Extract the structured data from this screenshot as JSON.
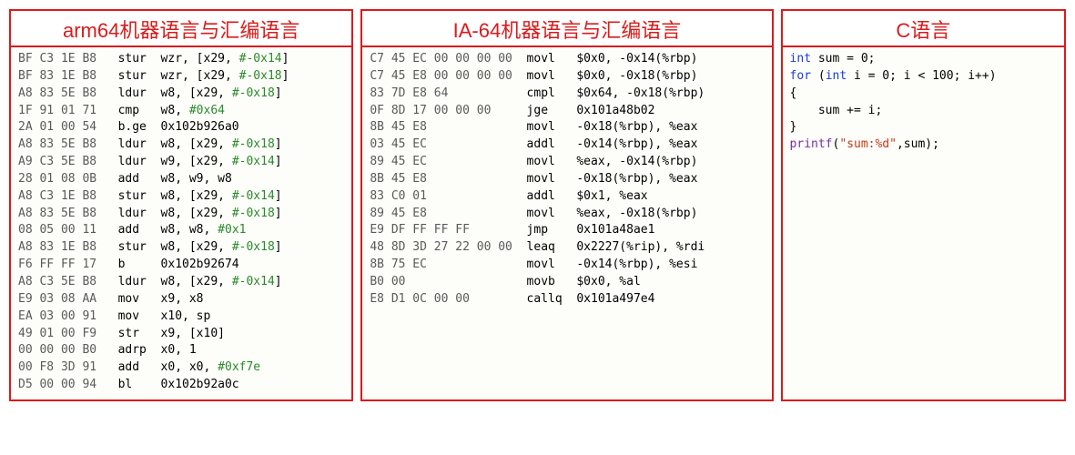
{
  "panels": [
    {
      "title": "arm64机器语言与汇编语言",
      "lines": [
        {
          "hex": "BF C3 1E B8",
          "mn": "stur",
          "op": "wzr, [x29, ",
          "imm": "#-0x14",
          "tail": "]"
        },
        {
          "hex": "BF 83 1E B8",
          "mn": "stur",
          "op": "wzr, [x29, ",
          "imm": "#-0x18",
          "tail": "]"
        },
        {
          "hex": "A8 83 5E B8",
          "mn": "ldur",
          "op": "w8, [x29, ",
          "imm": "#-0x18",
          "tail": "]"
        },
        {
          "hex": "1F 91 01 71",
          "mn": "cmp",
          "op": "w8, ",
          "imm": "#0x64",
          "tail": ""
        },
        {
          "hex": "2A 01 00 54",
          "mn": "b.ge",
          "op": "0x102b926a0",
          "imm": "",
          "tail": ""
        },
        {
          "hex": "A8 83 5E B8",
          "mn": "ldur",
          "op": "w8, [x29, ",
          "imm": "#-0x18",
          "tail": "]"
        },
        {
          "hex": "A9 C3 5E B8",
          "mn": "ldur",
          "op": "w9, [x29, ",
          "imm": "#-0x14",
          "tail": "]"
        },
        {
          "hex": "28 01 08 0B",
          "mn": "add",
          "op": "w8, w9, w8",
          "imm": "",
          "tail": ""
        },
        {
          "hex": "A8 C3 1E B8",
          "mn": "stur",
          "op": "w8, [x29, ",
          "imm": "#-0x14",
          "tail": "]"
        },
        {
          "hex": "A8 83 5E B8",
          "mn": "ldur",
          "op": "w8, [x29, ",
          "imm": "#-0x18",
          "tail": "]"
        },
        {
          "hex": "08 05 00 11",
          "mn": "add",
          "op": "w8, w8, ",
          "imm": "#0x1",
          "tail": ""
        },
        {
          "hex": "A8 83 1E B8",
          "mn": "stur",
          "op": "w8, [x29, ",
          "imm": "#-0x18",
          "tail": "]"
        },
        {
          "hex": "F6 FF FF 17",
          "mn": "b",
          "op": "0x102b92674",
          "imm": "",
          "tail": ""
        },
        {
          "hex": "A8 C3 5E B8",
          "mn": "ldur",
          "op": "w8, [x29, ",
          "imm": "#-0x14",
          "tail": "]"
        },
        {
          "hex": "E9 03 08 AA",
          "mn": "mov",
          "op": "x9, x8",
          "imm": "",
          "tail": ""
        },
        {
          "hex": "EA 03 00 91",
          "mn": "mov",
          "op": "x10, sp",
          "imm": "",
          "tail": ""
        },
        {
          "hex": "49 01 00 F9",
          "mn": "str",
          "op": "x9, [x10]",
          "imm": "",
          "tail": ""
        },
        {
          "hex": "00 00 00 B0",
          "mn": "adrp",
          "op": "x0, 1",
          "imm": "",
          "tail": ""
        },
        {
          "hex": "00 F8 3D 91",
          "mn": "add",
          "op": "x0, x0, ",
          "imm": "#0xf7e",
          "tail": ""
        },
        {
          "hex": "D5 00 00 94",
          "mn": "bl",
          "op": "0x102b92a0c",
          "imm": "",
          "tail": ""
        }
      ]
    },
    {
      "title": "IA-64机器语言与汇编语言",
      "lines": [
        {
          "hex": "C7 45 EC 00 00 00 00",
          "mn": "movl",
          "op": "$0x0, -0x14(%rbp)"
        },
        {
          "hex": "C7 45 E8 00 00 00 00",
          "mn": "movl",
          "op": "$0x0, -0x18(%rbp)"
        },
        {
          "hex": "83 7D E8 64",
          "mn": "cmpl",
          "op": "$0x64, -0x18(%rbp)"
        },
        {
          "hex": "0F 8D 17 00 00 00",
          "mn": "jge",
          "op": "0x101a48b02"
        },
        {
          "hex": "8B 45 E8",
          "mn": "movl",
          "op": "-0x18(%rbp), %eax"
        },
        {
          "hex": "03 45 EC",
          "mn": "addl",
          "op": "-0x14(%rbp), %eax"
        },
        {
          "hex": "89 45 EC",
          "mn": "movl",
          "op": "%eax, -0x14(%rbp)"
        },
        {
          "hex": "8B 45 E8",
          "mn": "movl",
          "op": "-0x18(%rbp), %eax"
        },
        {
          "hex": "83 C0 01",
          "mn": "addl",
          "op": "$0x1, %eax"
        },
        {
          "hex": "89 45 E8",
          "mn": "movl",
          "op": "%eax, -0x18(%rbp)"
        },
        {
          "hex": "E9 DF FF FF FF",
          "mn": "jmp",
          "op": "0x101a48ae1"
        },
        {
          "hex": "48 8D 3D 27 22 00 00",
          "mn": "leaq",
          "op": "0x2227(%rip), %rdi"
        },
        {
          "hex": "8B 75 EC",
          "mn": "movl",
          "op": "-0x14(%rbp), %esi"
        },
        {
          "hex": "B0 00",
          "mn": "movb",
          "op": "$0x0, %al"
        },
        {
          "hex": "E8 D1 0C 00 00",
          "mn": "callq",
          "op": "0x101a497e4"
        }
      ]
    },
    {
      "title": "C语言",
      "code": {
        "l1a": "int",
        "l1b": " sum = 0;",
        "l2a": "for",
        "l2b": " (",
        "l2c": "int",
        "l2d": " i = 0; i < 100; i++)",
        "l3": "{",
        "l4": "    sum += i;",
        "l5": "}",
        "l6a": "printf",
        "l6b": "(",
        "l6c": "\"sum:%d\"",
        "l6d": ",sum);"
      }
    }
  ]
}
